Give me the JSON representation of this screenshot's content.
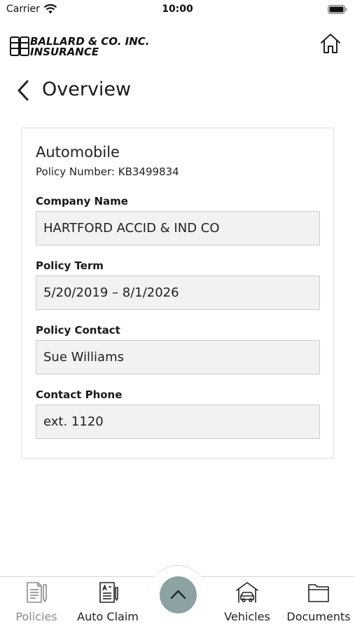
{
  "status_bar": {
    "carrier": "Carrier",
    "time": "10:00"
  },
  "header": {
    "logo_line1": "BALLARD & CO. INC.",
    "logo_line2": "INSURANCE"
  },
  "page": {
    "title": "Overview"
  },
  "policy": {
    "type": "Automobile",
    "policy_number": "Policy Number: KB3499834",
    "fields": [
      {
        "label": "Company Name",
        "value": "HARTFORD ACCID & IND CO"
      },
      {
        "label": "Policy Term",
        "value": "5/20/2019 – 8/1/2026"
      },
      {
        "label": "Policy Contact",
        "value": "Sue Williams"
      },
      {
        "label": "Contact Phone",
        "value": "ext. 1120"
      }
    ]
  },
  "tabs": [
    {
      "label": "Policies",
      "icon": "document-pen-icon",
      "active": true
    },
    {
      "label": "Auto Claim",
      "icon": "claim-form-icon",
      "active": false
    },
    {
      "label": "Vehicles",
      "icon": "car-garage-icon",
      "active": false
    },
    {
      "label": "Documents",
      "icon": "folder-icon",
      "active": false
    }
  ],
  "colors": {
    "fab": "#8da3a3",
    "inactive_tab_label": "#8a8a8a",
    "field_background": "#f2f2f2"
  }
}
